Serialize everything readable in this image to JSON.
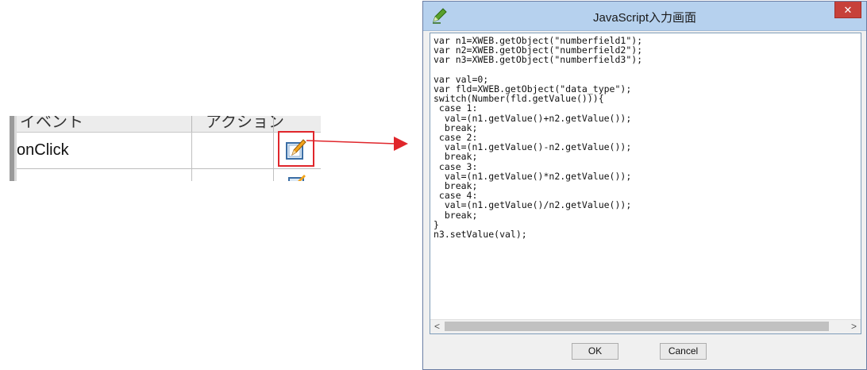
{
  "grid": {
    "header": {
      "col1": "イベント",
      "col2": "アクション"
    },
    "row": {
      "event": "onClick"
    }
  },
  "dialog": {
    "title": "JavaScript入力画面",
    "close_glyph": "✕",
    "code": "var n1=XWEB.getObject(\"numberfield1\");\nvar n2=XWEB.getObject(\"numberfield2\");\nvar n3=XWEB.getObject(\"numberfield3\");\n\nvar val=0;\nvar fld=XWEB.getObject(\"data_type\");\nswitch(Number(fld.getValue())){\n case 1:\n  val=(n1.getValue()+n2.getValue());\n  break;\n case 2:\n  val=(n1.getValue()-n2.getValue());\n  break;\n case 3:\n  val=(n1.getValue()*n2.getValue());\n  break;\n case 4:\n  val=(n1.getValue()/n2.getValue());\n  break;\n}\nn3.setValue(val);",
    "scroll_left": "<",
    "scroll_right": ">",
    "ok_label": "OK",
    "cancel_label": "Cancel"
  },
  "colors": {
    "highlight": "#e0262b",
    "titlebar": "#b6d1ee",
    "close": "#c7413a"
  },
  "icons": [
    "edit-icon",
    "pencil-icon",
    "arrow-right-icon",
    "close-icon"
  ]
}
